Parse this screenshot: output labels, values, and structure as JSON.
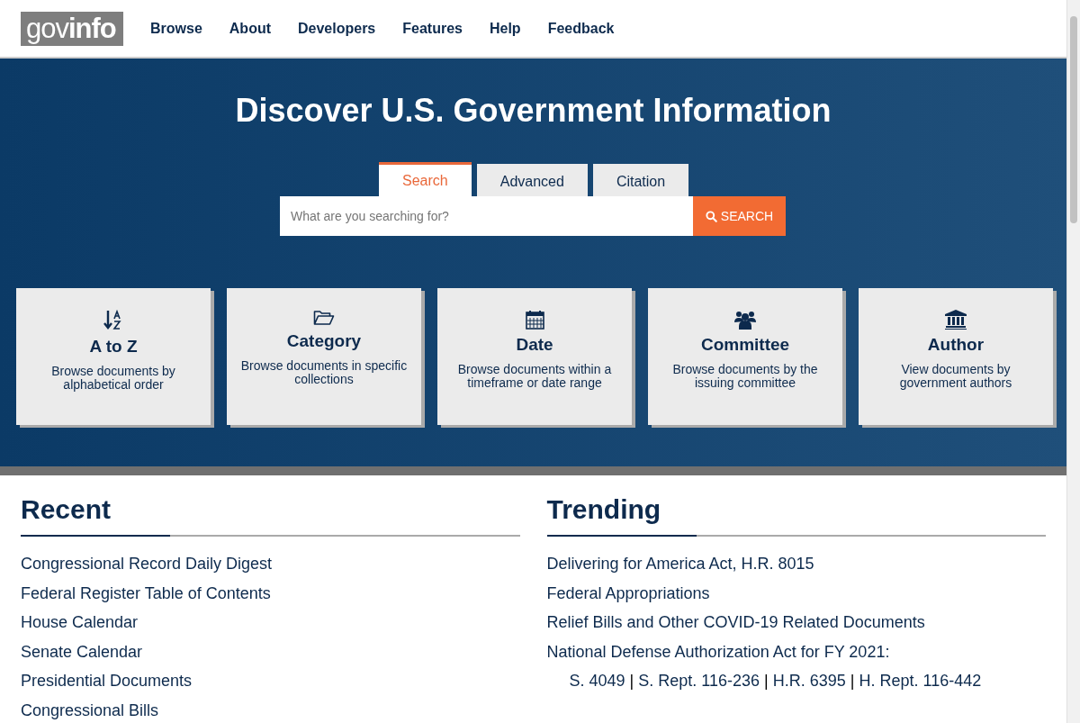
{
  "logo": {
    "light": "gov",
    "bold": "info"
  },
  "nav": [
    "Browse",
    "About",
    "Developers",
    "Features",
    "Help",
    "Feedback"
  ],
  "hero": {
    "title": "Discover U.S. Government Information",
    "tabs": [
      {
        "label": "Search",
        "selected": true
      },
      {
        "label": "Advanced",
        "selected": false
      },
      {
        "label": "Citation",
        "selected": false
      }
    ],
    "search": {
      "placeholder": "What are you searching for?",
      "button": "SEARCH"
    },
    "cards": [
      {
        "kind": "atoz",
        "title": "A to Z",
        "text": "Browse documents by alphabetical order"
      },
      {
        "kind": "category",
        "title": "Category",
        "text": "Browse documents in specific collections"
      },
      {
        "kind": "date",
        "title": "Date",
        "text": "Browse documents within a timeframe or date range"
      },
      {
        "kind": "committee",
        "title": "Committee",
        "text": "Browse documents by the issuing committee"
      },
      {
        "kind": "author",
        "title": "Author",
        "text": "View documents by government authors"
      }
    ]
  },
  "recent": {
    "title": "Recent",
    "items": [
      "Congressional Record Daily Digest",
      "Federal Register Table of Contents",
      "House Calendar",
      "Senate Calendar",
      "Presidential Documents",
      "Congressional Bills"
    ]
  },
  "trending": {
    "title": "Trending",
    "items": [
      {
        "label": "Delivering for America Act, H.R. 8015"
      },
      {
        "label": "Federal Appropriations"
      },
      {
        "label": "Relief Bills and Other COVID-19 Related Documents"
      },
      {
        "label": "National Defense Authorization Act for FY 2021:",
        "children": [
          {
            "kind": "link",
            "label": "S. 4049"
          },
          {
            "kind": "separator",
            "label": "|"
          },
          {
            "kind": "link",
            "label": "S. Rept. 116-236"
          },
          {
            "kind": "separator",
            "label": "|"
          },
          {
            "kind": "link",
            "label": "H.R. 6395"
          },
          {
            "kind": "separator",
            "label": "|"
          },
          {
            "kind": "link",
            "label": "H. Rept. 116-442"
          }
        ]
      }
    ]
  }
}
